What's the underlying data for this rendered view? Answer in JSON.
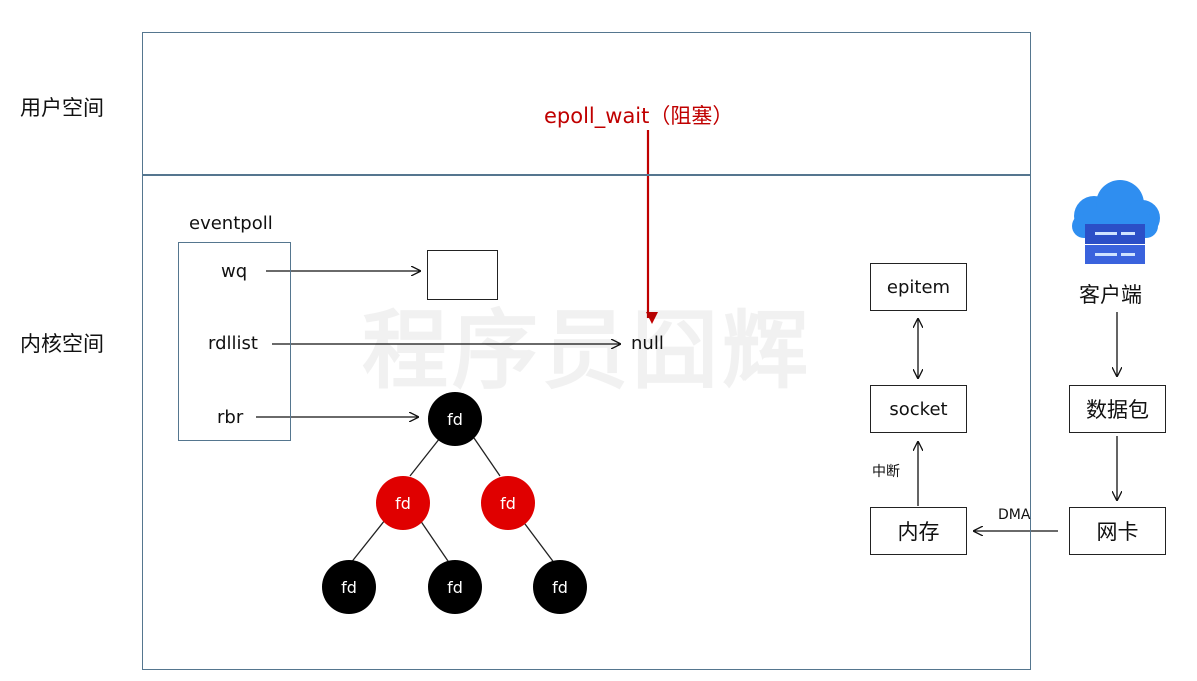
{
  "regions": {
    "user_space": "用户空间",
    "kernel_space": "内核空间"
  },
  "epoll_wait": {
    "label": "epoll_wait（阻塞）",
    "color": "#c00000"
  },
  "eventpoll": {
    "title": "eventpoll",
    "fields": [
      "wq",
      "rdllist",
      "rbr"
    ]
  },
  "null_label": "null",
  "rb_tree": {
    "root": "fd",
    "level2": [
      "fd",
      "fd"
    ],
    "level3": [
      "fd",
      "fd",
      "fd"
    ],
    "colors": {
      "black": "#000000",
      "red": "#e00000"
    }
  },
  "kernel_flow": {
    "epitem": "epitem",
    "socket": "socket",
    "interrupt": "中断",
    "memory": "内存",
    "dma": "DMA"
  },
  "client_flow": {
    "client": "客户端",
    "packet": "数据包",
    "nic": "网卡"
  },
  "watermark": "程序员囧辉",
  "colors": {
    "frame": "#55768f",
    "cloud": "#2f8ef0",
    "server": "#2b4fc7"
  }
}
